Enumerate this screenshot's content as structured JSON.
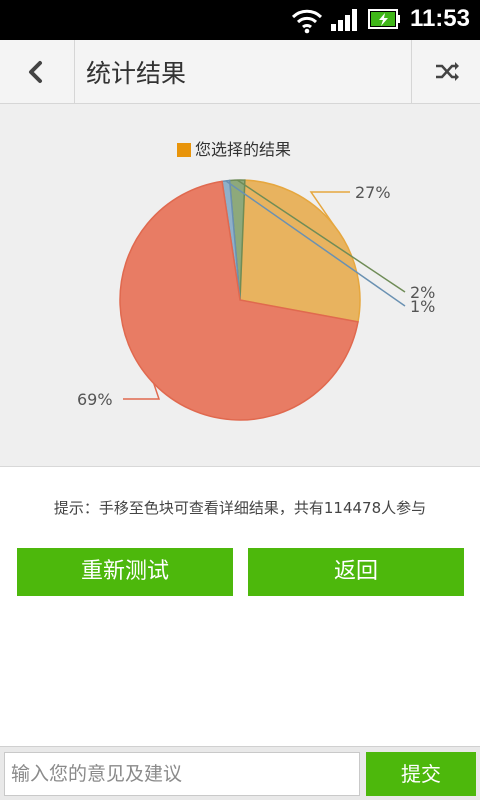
{
  "status_bar": {
    "time": "11:53"
  },
  "header": {
    "title": "统计结果"
  },
  "legend": {
    "label": "您选择的结果"
  },
  "chart_data": {
    "type": "pie",
    "title": "",
    "series": [
      {
        "name": "您选择的结果",
        "values": [
          27,
          2,
          1,
          69
        ]
      }
    ],
    "slices": [
      {
        "value": 27,
        "label": "27%",
        "color": "#e8b35f"
      },
      {
        "value": 2,
        "label": "2%",
        "color": "#8ea97b"
      },
      {
        "value": 1,
        "label": "1%",
        "color": "#8fb0c9"
      },
      {
        "value": 69,
        "label": "69%",
        "color": "#e87c64"
      }
    ],
    "legend_position": "top"
  },
  "hint": {
    "text": "提示：手移至色块可查看详细结果，共有114478人参与"
  },
  "buttons": {
    "retry": "重新测试",
    "back": "返回"
  },
  "feedback": {
    "placeholder": "输入您的意见及建议",
    "submit": "提交"
  }
}
